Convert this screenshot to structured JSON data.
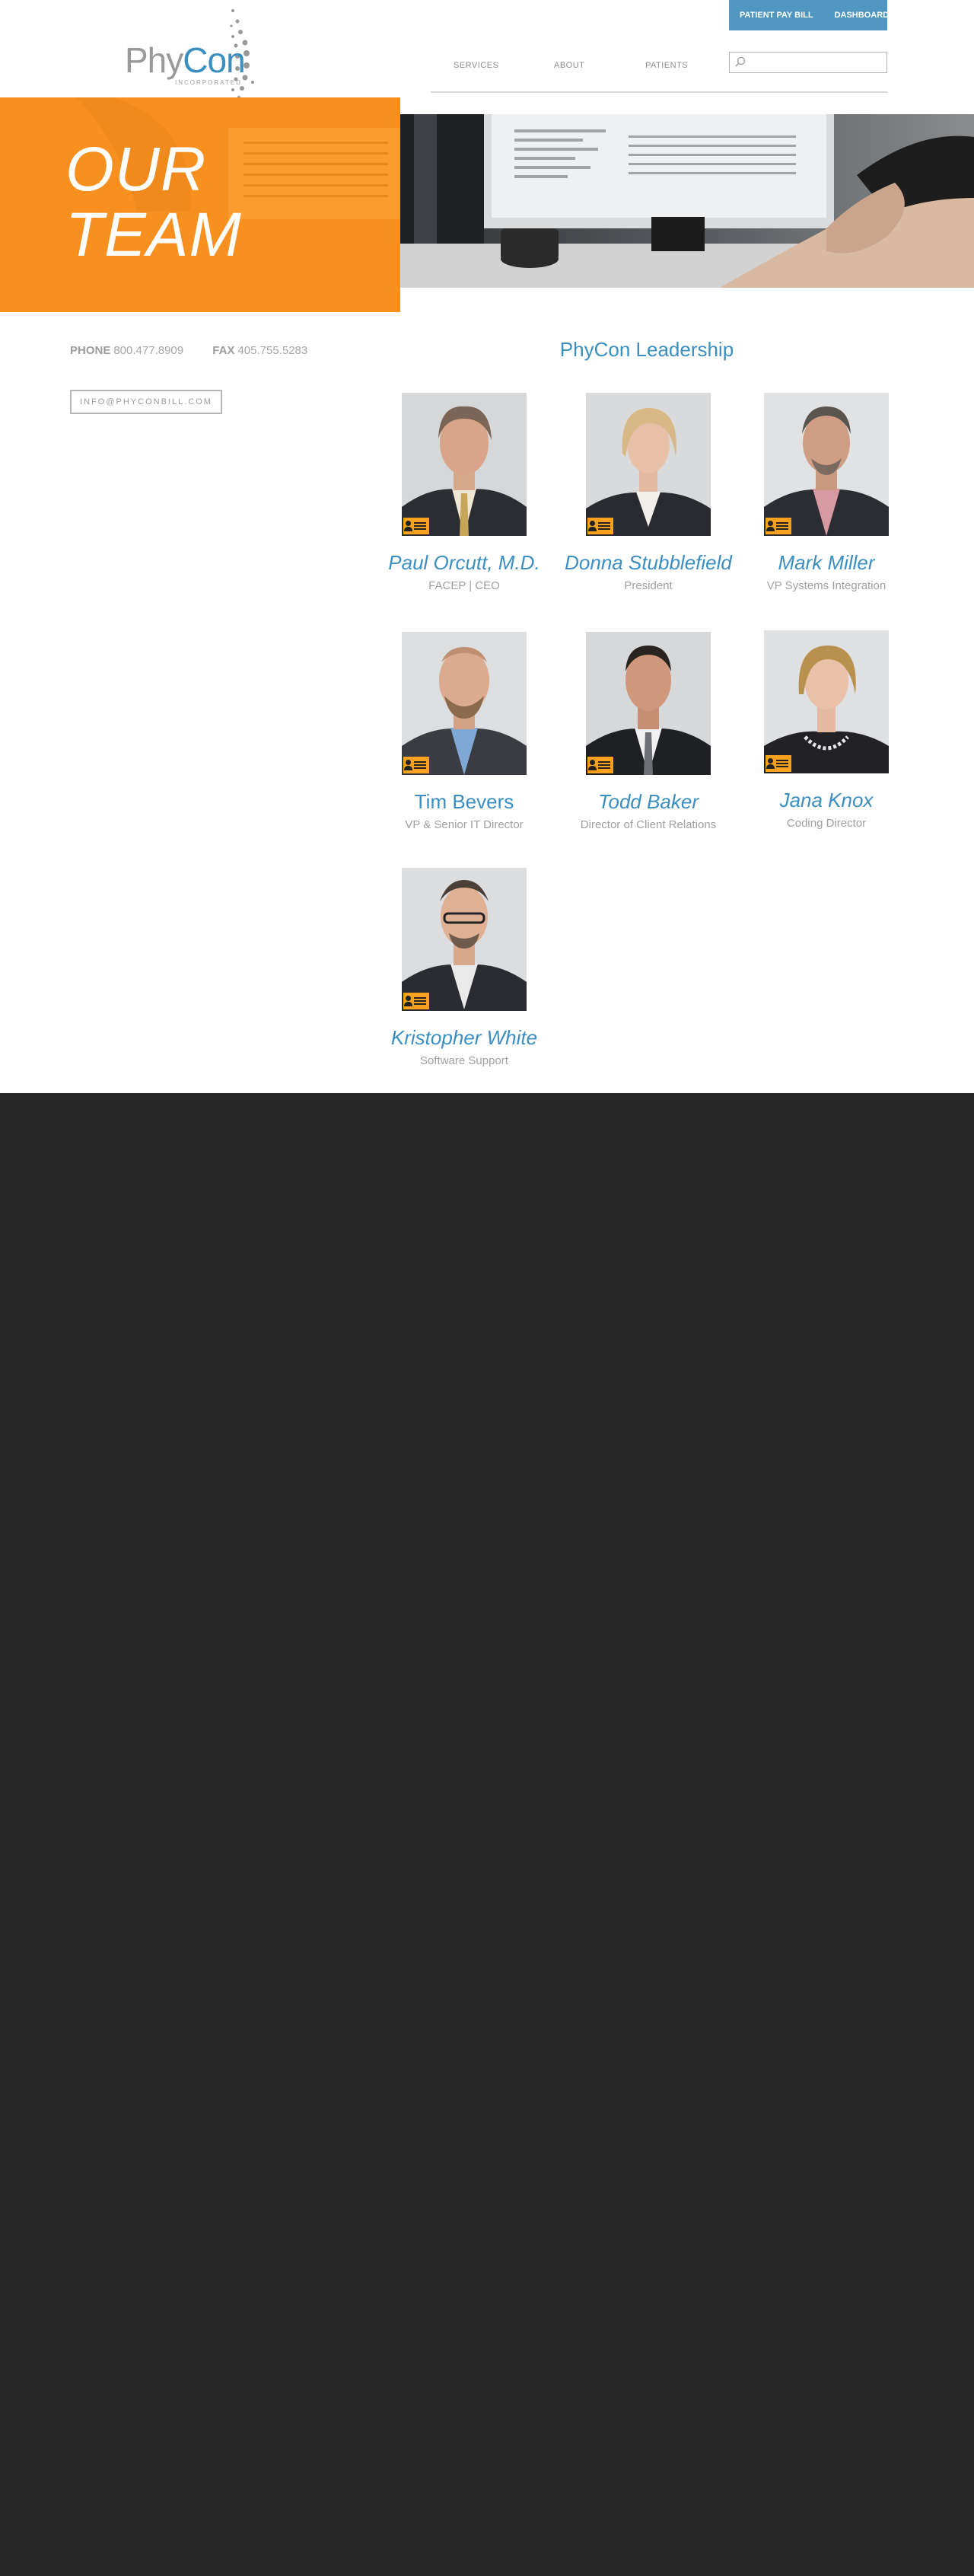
{
  "header": {
    "logo_primary": "Phy",
    "logo_secondary": "Con",
    "logo_subtitle": "INCORPORATED",
    "top_buttons": [
      "PATIENT PAY BILL",
      "DASHBOARD"
    ],
    "nav": [
      "SERVICES",
      "ABOUT",
      "PATIENTS"
    ],
    "search_placeholder": ""
  },
  "hero": {
    "title_line1": "OUR",
    "title_line2": "TEAM"
  },
  "contact": {
    "phone_label": "PHONE",
    "phone": "800.477.8909",
    "fax_label": "FAX",
    "fax": "405.755.5283",
    "email": "INFO@PHYCONBILL.COM"
  },
  "leadership": {
    "title": "PhyCon Leadership",
    "members": [
      {
        "name": "Paul Orcutt, M.D.",
        "role": "FACEP | CEO"
      },
      {
        "name": "Donna Stubblefield",
        "role": "President"
      },
      {
        "name": "Mark Miller",
        "role": "VP Systems Integration"
      },
      {
        "name": "Tim Bevers",
        "role": "VP & Senior IT Director"
      },
      {
        "name": "Todd Baker",
        "role": "Director of Client Relations"
      },
      {
        "name": "Jana Knox",
        "role": "Coding Director"
      },
      {
        "name": "Kristopher White",
        "role": "Software Support"
      }
    ]
  },
  "colors": {
    "brand_blue": "#3b8fc0",
    "brand_orange": "#f7901e",
    "footer_dark": "#262626"
  }
}
